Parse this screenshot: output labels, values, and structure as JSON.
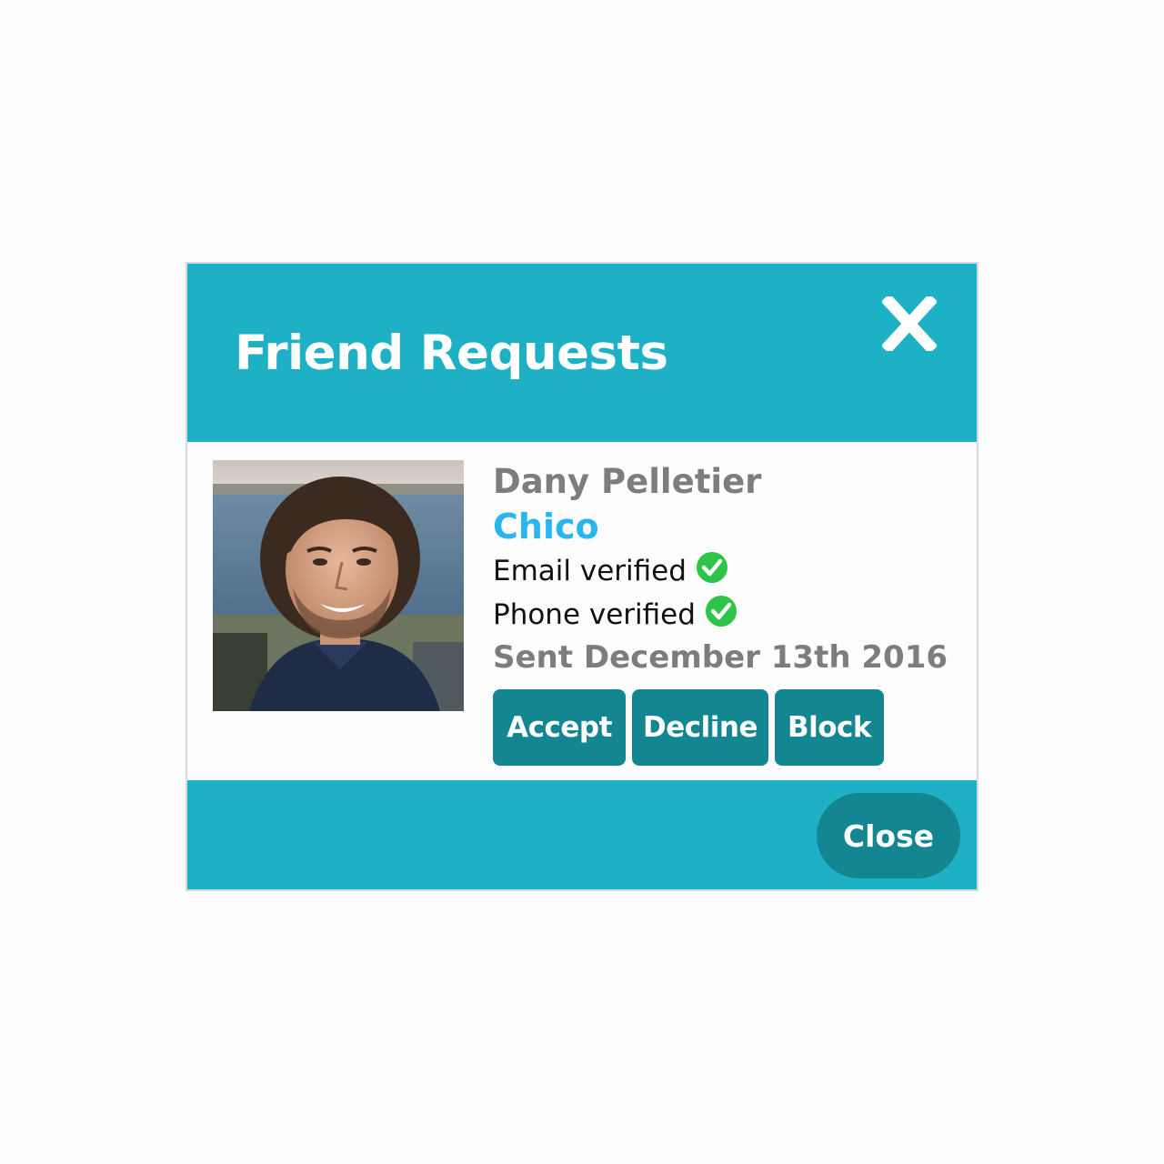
{
  "modal": {
    "title": "Friend Requests",
    "close_icon": "close-x-icon"
  },
  "request": {
    "name": "Dany Pelletier",
    "username": "Chico",
    "email_status": "Email verified",
    "phone_status": "Phone verified",
    "sent": "Sent December 13th 2016",
    "check_icon": "check-circle-icon"
  },
  "actions": {
    "accept_label": "Accept",
    "decline_label": "Decline",
    "block_label": "Block"
  },
  "footer": {
    "close_label": "Close"
  },
  "colors": {
    "header": "#1eb1c6",
    "button": "#148692",
    "username": "#29b6f0",
    "muted_text": "#7d7d7d",
    "check": "#2ec44a"
  }
}
